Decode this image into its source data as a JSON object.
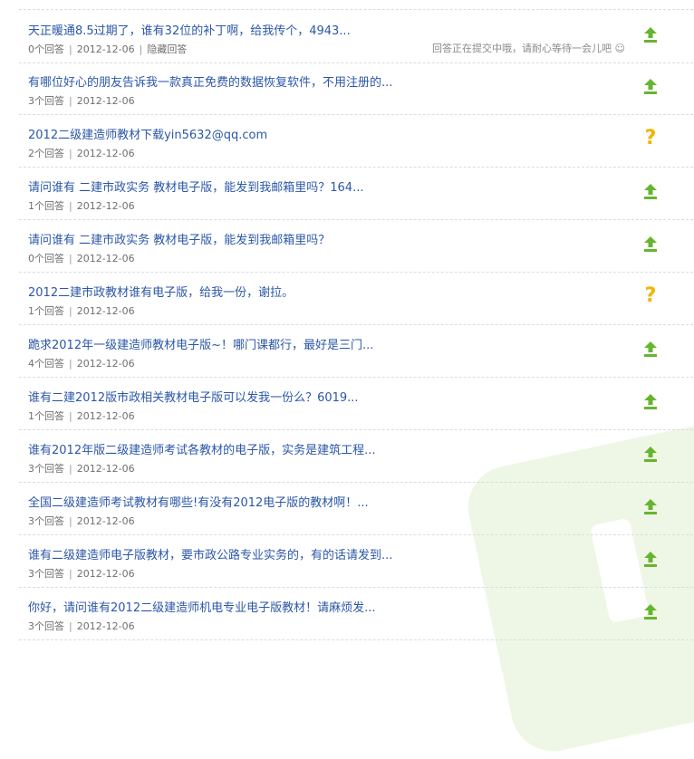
{
  "colors": {
    "link": "#2b57a8",
    "meta": "#6f6f6f",
    "upload_icon": "#66b52f",
    "pending_icon": "#f2b400",
    "watermark": "#eef7e5"
  },
  "notice_text": "回答正在提交中哦，请耐心等待一会儿吧 ☺",
  "hide_label": "隐藏回答",
  "questions": [
    {
      "title": "天正暖通8.5过期了，谁有32位的补丁啊，给我传个，4943...",
      "answers": "0个回答",
      "date": "2012-12-06",
      "icon": "upload-icon"
    },
    {
      "title": "有哪位好心的朋友告诉我一款真正免费的数据恢复软件，不用注册的...",
      "answers": "3个回答",
      "date": "2012-12-06",
      "icon": "upload-icon"
    },
    {
      "title": "2012二级建造师教材下载yin5632@qq.com",
      "answers": "2个回答",
      "date": "2012-12-06",
      "icon": "question-mark-icon"
    },
    {
      "title": "请问谁有 二建市政实务 教材电子版，能发到我邮箱里吗？164...",
      "answers": "1个回答",
      "date": "2012-12-06",
      "icon": "upload-icon"
    },
    {
      "title": "请问谁有 二建市政实务 教材电子版，能发到我邮箱里吗？",
      "answers": "0个回答",
      "date": "2012-12-06",
      "icon": "upload-icon"
    },
    {
      "title": "2012二建市政教材谁有电子版，给我一份，谢拉。",
      "answers": "1个回答",
      "date": "2012-12-06",
      "icon": "question-mark-icon"
    },
    {
      "title": "跪求2012年一级建造师教材电子版~！哪门课都行，最好是三门...",
      "answers": "4个回答",
      "date": "2012-12-06",
      "icon": "upload-icon"
    },
    {
      "title": "谁有二建2012版市政相关教材电子版可以发我一份么？6019...",
      "answers": "1个回答",
      "date": "2012-12-06",
      "icon": "upload-icon"
    },
    {
      "title": "谁有2012年版二级建造师考试各教材的电子版，实务是建筑工程...",
      "answers": "3个回答",
      "date": "2012-12-06",
      "icon": "upload-icon"
    },
    {
      "title": "全国二级建造师考试教材有哪些!有没有2012电子版的教材啊！...",
      "answers": "3个回答",
      "date": "2012-12-06",
      "icon": "upload-icon"
    },
    {
      "title": "谁有二级建造师电子版教材，要市政公路专业实务的，有的话请发到...",
      "answers": "3个回答",
      "date": "2012-12-06",
      "icon": "upload-icon"
    },
    {
      "title": "你好，请问谁有2012二级建造师机电专业电子版教材！请麻烦发...",
      "answers": "3个回答",
      "date": "2012-12-06",
      "icon": "upload-icon"
    }
  ]
}
